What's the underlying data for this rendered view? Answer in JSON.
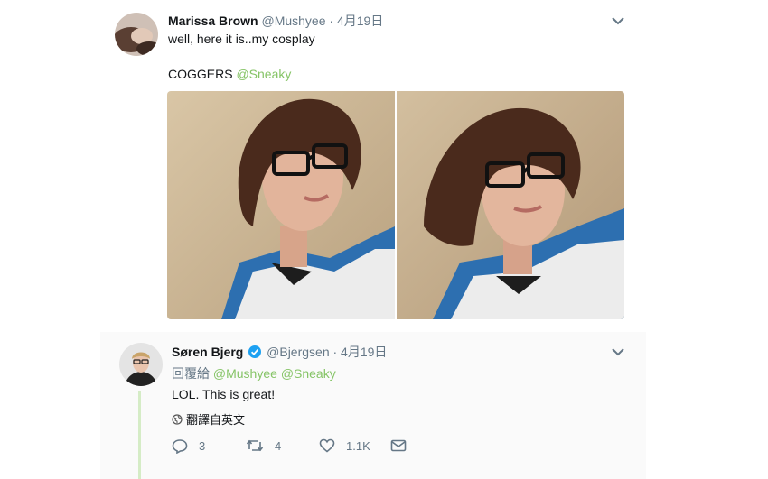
{
  "tweet1": {
    "display_name": "Marissa Brown",
    "handle": "@Mushyee",
    "date": "· 4月19日",
    "text_line1": "well, here it is..my cosplay",
    "text_word": "COGGERS",
    "mention": "@Sneaky"
  },
  "tweet2": {
    "display_name": "Søren Bjerg",
    "handle": "@Bjergsen",
    "date": "· 4月19日",
    "reply_prefix": "回覆給",
    "reply_to_1": "@Mushyee",
    "reply_to_2": "@Sneaky",
    "text": "LOL. This is great!",
    "translate_label": "翻譯自英文",
    "replies": "3",
    "retweets": "4",
    "likes": "1.1K"
  },
  "colors": {
    "link": "#86c467",
    "muted": "#657786",
    "verified": "#1da1f2",
    "thread_line": "#d5ecc6"
  }
}
